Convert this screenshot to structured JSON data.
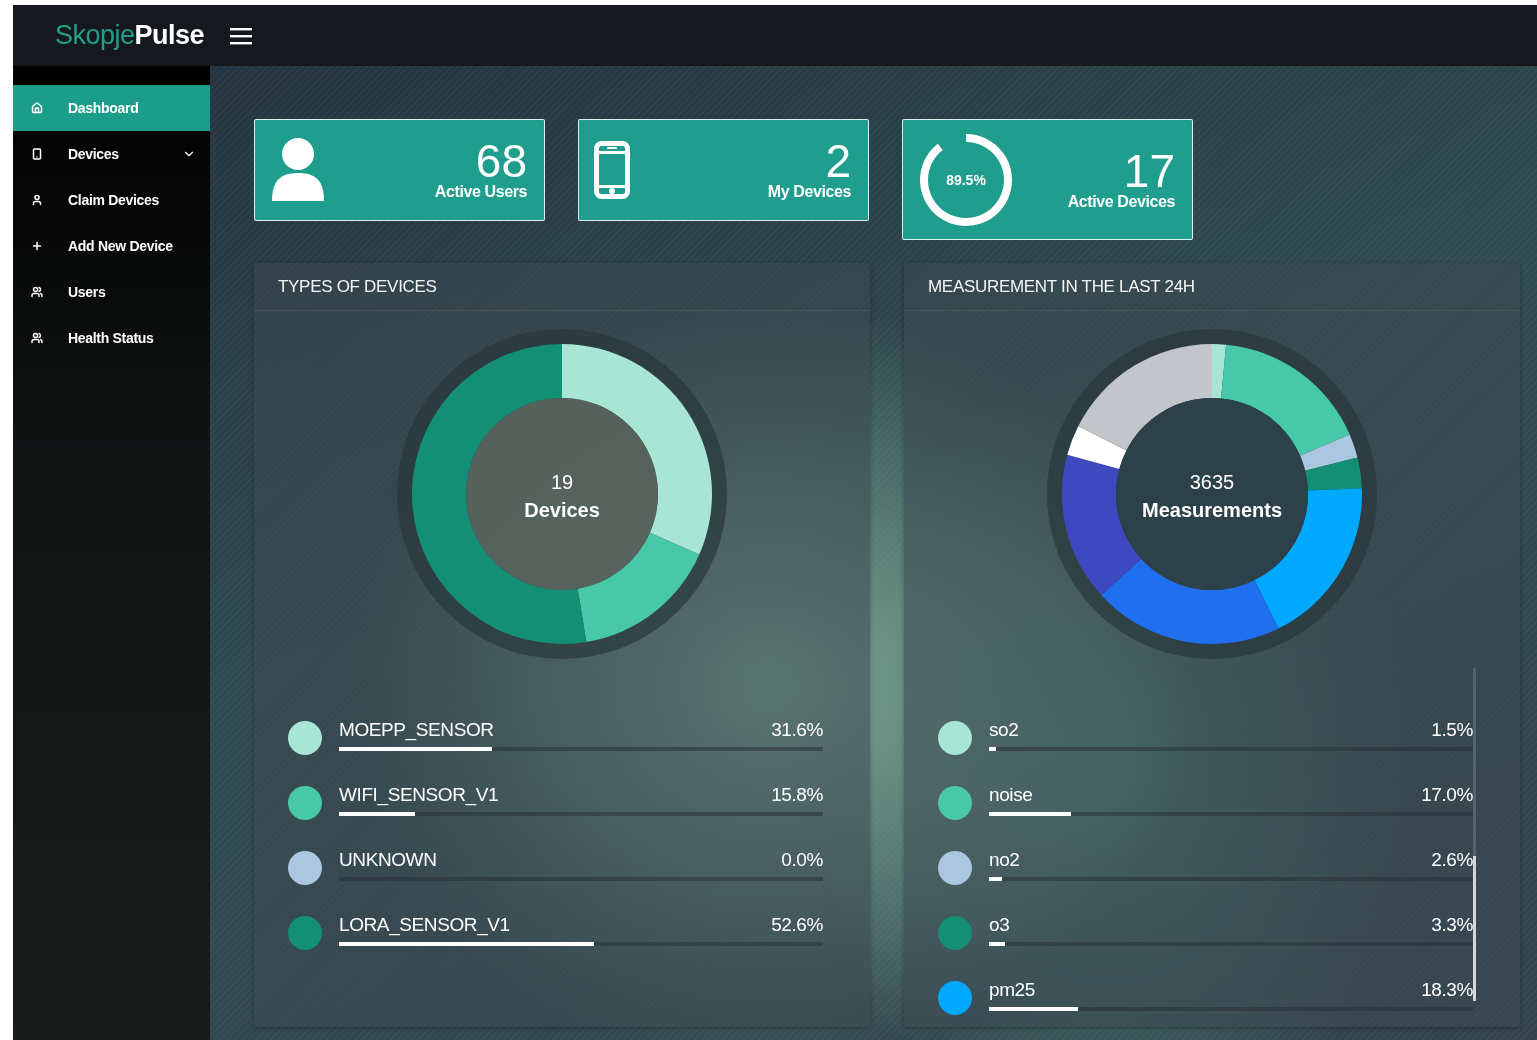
{
  "logo": {
    "first": "Skopje",
    "second": "Pulse"
  },
  "sidebar": {
    "items": [
      {
        "label": "Dashboard",
        "selected": true
      },
      {
        "label": "Devices",
        "selected": false,
        "expandable": true
      },
      {
        "label": "Claim Devices",
        "selected": false
      },
      {
        "label": "Add New Device",
        "selected": false
      },
      {
        "label": "Users",
        "selected": false
      },
      {
        "label": "Health Status",
        "selected": false
      }
    ]
  },
  "stats": [
    {
      "kind": "user",
      "value": "68",
      "label": "Active Users"
    },
    {
      "kind": "phone",
      "value": "2",
      "label": "My Devices"
    },
    {
      "kind": "gauge",
      "value": "17",
      "label": "Active Devices",
      "reading": "89.5%"
    }
  ],
  "panels": [
    {
      "kind": "complete",
      "title": "TYPES OF DEVICES",
      "center_value": "19",
      "center_label": "Devices",
      "legend": [
        {
          "name": "MOEPP_SENSOR",
          "percent": "31.6%",
          "level": 0.316,
          "color": "#a8e5d5"
        },
        {
          "name": "WIFI_SENSOR_V1",
          "percent": "15.8%",
          "level": 0.158,
          "color": "#47c8a8"
        },
        {
          "name": "UNKNOWN",
          "percent": "0.0%",
          "color": "#aac6e0"
        },
        {
          "name": "LORA_SENSOR_V1",
          "percent": "52.6%",
          "level": 0.526,
          "color": "#128f74"
        }
      ]
    },
    {
      "kind": "partial",
      "title": "MEASUREMENT IN THE LAST 24H",
      "center_value": "3635",
      "center_label": "Measurements",
      "scrollable": true,
      "legend": [
        {
          "name": "so2",
          "percent": "1.5%",
          "level": 0.015,
          "color": "#a8e5d5"
        },
        {
          "name": "noise",
          "percent": "17.0%",
          "level": 0.17,
          "color": "#47c8a8"
        },
        {
          "name": "no2",
          "percent": "2.6%",
          "level": 0.026,
          "color": "#aac6e0"
        },
        {
          "name": "o3",
          "percent": "3.3%",
          "level": 0.033,
          "color": "#128f74"
        },
        {
          "name": "pm25",
          "percent": "18.3%",
          "level": 0.183,
          "color": "#00a8ff"
        }
      ]
    }
  ]
}
